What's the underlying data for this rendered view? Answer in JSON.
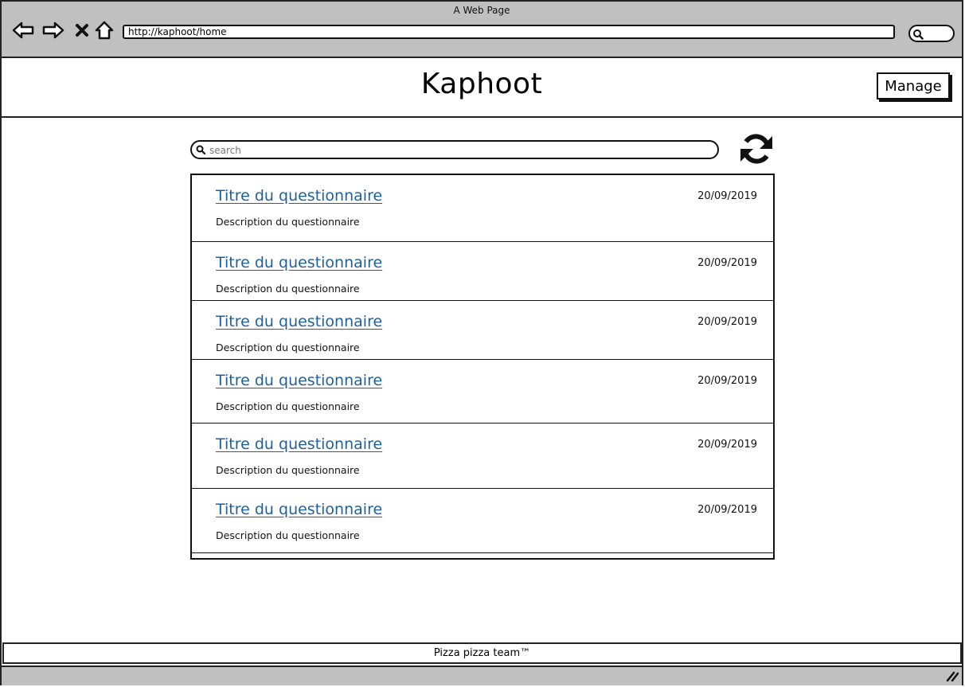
{
  "browser": {
    "window_title": "A Web Page",
    "url": "http://kaphoot/home",
    "icons": [
      "back-arrow-icon",
      "forward-arrow-icon",
      "close-x-icon",
      "home-icon",
      "search-icon"
    ]
  },
  "header": {
    "app_title": "Kaphoot",
    "manage_label": "Manage"
  },
  "search": {
    "placeholder": "search",
    "value": ""
  },
  "refresh": {
    "icon": "refresh-icon"
  },
  "questionnaires": [
    {
      "title": "Titre du questionnaire",
      "date": "20/09/2019",
      "description": "Description du questionnaire"
    },
    {
      "title": "Titre du questionnaire",
      "date": "20/09/2019",
      "description": "Description du questionnaire"
    },
    {
      "title": "Titre du questionnaire",
      "date": "20/09/2019",
      "description": "Description du questionnaire"
    },
    {
      "title": "Titre du questionnaire",
      "date": "20/09/2019",
      "description": "Description du questionnaire"
    },
    {
      "title": "Titre du questionnaire",
      "date": "20/09/2019",
      "description": "Description du questionnaire"
    },
    {
      "title": "Titre du questionnaire",
      "date": "20/09/2019",
      "description": "Description du questionnaire"
    }
  ],
  "footer": {
    "text": "Pizza pizza team™"
  },
  "colors": {
    "chrome": "#c0c0c0",
    "link": "#1f5f9e",
    "border": "#111111"
  }
}
